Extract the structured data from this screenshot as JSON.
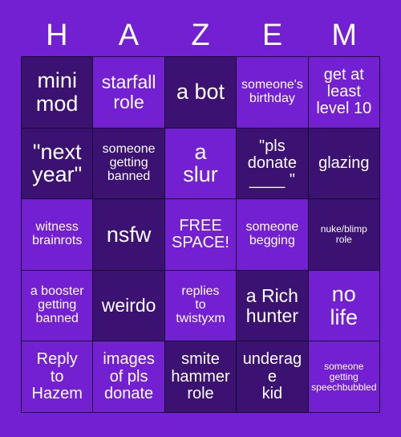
{
  "colors": {
    "background": "#7320d3",
    "cell_dark": "#3b1172",
    "cell_bright": "#7320d3",
    "grid_line": "#15062b",
    "text": "#ffffff"
  },
  "header": {
    "letters": [
      {
        "label": "H"
      },
      {
        "label": "A"
      },
      {
        "label": "Z"
      },
      {
        "label": "E"
      },
      {
        "label": "M"
      }
    ]
  },
  "grid": {
    "rows": 5,
    "columns": 5,
    "cells": [
      {
        "text": "mini\nmod",
        "shade": "dark",
        "size": "fs-xl"
      },
      {
        "text": "starfall\nrole",
        "shade": "bright",
        "size": "fs-lg"
      },
      {
        "text": "a bot",
        "shade": "dark",
        "size": "fs-xl"
      },
      {
        "text": "someone's\nbirthday",
        "shade": "bright",
        "size": "fs-sm"
      },
      {
        "text": "get at\nleast\nlevel 10",
        "shade": "bright",
        "size": "fs-md"
      },
      {
        "text": "\"next\nyear\"",
        "shade": "dark",
        "size": "fs-xl"
      },
      {
        "text": "someone\ngetting\nbanned",
        "shade": "dark",
        "size": "fs-sm"
      },
      {
        "text": "a\nslur",
        "shade": "bright",
        "size": "fs-xl"
      },
      {
        "text": "\"pls\ndonate\n____ \"",
        "shade": "dark",
        "size": "fs-md"
      },
      {
        "text": "glazing",
        "shade": "dark",
        "size": "fs-md"
      },
      {
        "text": "witness\nbrainrots",
        "shade": "bright",
        "size": "fs-sm"
      },
      {
        "text": "nsfw",
        "shade": "dark",
        "size": "fs-xl"
      },
      {
        "text": "FREE\nSPACE!",
        "shade": "bright",
        "size": "fs-md"
      },
      {
        "text": "someone\nbegging",
        "shade": "bright",
        "size": "fs-sm"
      },
      {
        "text": "nuke/blimp\nrole",
        "shade": "dark",
        "size": "fs-xs"
      },
      {
        "text": "a booster\ngetting\nbanned",
        "shade": "bright",
        "size": "fs-sm"
      },
      {
        "text": "weirdo",
        "shade": "dark",
        "size": "fs-lg"
      },
      {
        "text": "replies\nto\ntwistyxm",
        "shade": "bright",
        "size": "fs-sm"
      },
      {
        "text": "a Rich\nhunter",
        "shade": "dark",
        "size": "fs-lg"
      },
      {
        "text": "no\nlife",
        "shade": "bright",
        "size": "fs-xl"
      },
      {
        "text": "Reply\nto\nHazem",
        "shade": "bright",
        "size": "fs-md"
      },
      {
        "text": "images\nof pls\ndonate",
        "shade": "bright",
        "size": "fs-md"
      },
      {
        "text": "smite\nhammer\nrole",
        "shade": "dark",
        "size": "fs-md"
      },
      {
        "text": "underage\nkid",
        "shade": "dark",
        "size": "fs-md"
      },
      {
        "text": "someone\ngetting\nspeechbubbled",
        "shade": "bright",
        "size": "fs-xs"
      }
    ]
  }
}
